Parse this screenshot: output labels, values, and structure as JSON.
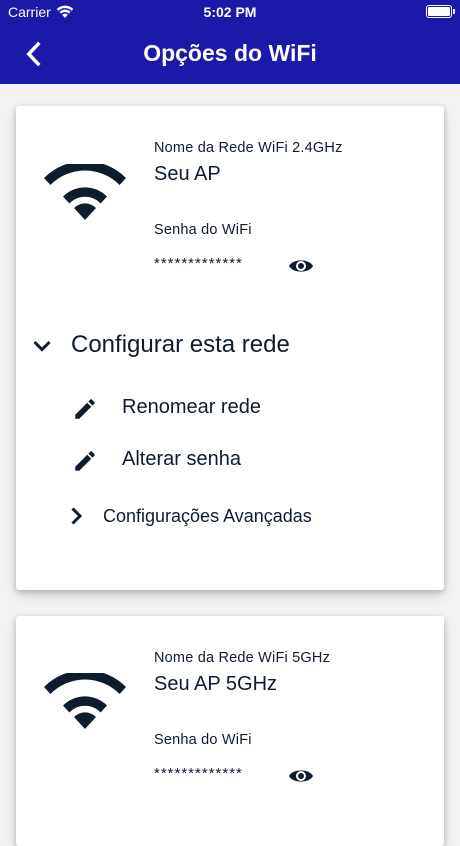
{
  "status_bar": {
    "carrier": "Carrier",
    "time": "5:02 PM"
  },
  "nav": {
    "title": "Opções do WiFi"
  },
  "networks": [
    {
      "name_label": "Nome da Rede WiFi 2.4GHz",
      "name": "Seu AP",
      "password_label": "Senha do WiFi",
      "password_masked": "*************",
      "configure": {
        "label": "Configurar esta rede",
        "actions": [
          {
            "label": "Renomear rede",
            "icon": "pencil-icon"
          },
          {
            "label": "Alterar senha",
            "icon": "pencil-icon"
          }
        ],
        "advanced_label": "Configurações Avançadas"
      }
    },
    {
      "name_label": "Nome da Rede WiFi 5GHz",
      "name": "Seu AP 5GHz",
      "password_label": "Senha do WiFi",
      "password_masked": "*************"
    }
  ],
  "colors": {
    "header": "#1a1aa8",
    "text": "#0f1c2e",
    "background": "#f2f2f2",
    "card": "#ffffff"
  },
  "icons": {
    "back": "chevron-left-icon",
    "wifi": "wifi-icon",
    "reveal_password": "eye-icon",
    "expand": "chevron-down-icon",
    "advanced": "chevron-right-icon"
  }
}
